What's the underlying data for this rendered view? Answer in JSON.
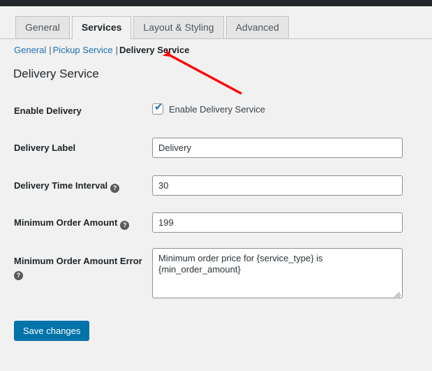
{
  "admin_bar": {
    "present": true,
    "color": "#23282d"
  },
  "tabs": [
    {
      "label": "General",
      "active": false
    },
    {
      "label": "Services",
      "active": true
    },
    {
      "label": "Layout & Styling",
      "active": false
    },
    {
      "label": "Advanced",
      "active": false
    }
  ],
  "subnav": {
    "items": [
      {
        "label": "General",
        "current": false
      },
      {
        "label": "Pickup Service",
        "current": false
      },
      {
        "label": "Delivery Service",
        "current": true
      }
    ],
    "separator": "|"
  },
  "page_title": "Delivery Service",
  "form": {
    "enable_delivery": {
      "label": "Enable Delivery",
      "checkbox_label": "Enable Delivery Service",
      "checked": true,
      "check_glyph": "✔"
    },
    "delivery_label": {
      "label": "Delivery Label",
      "value": "Delivery",
      "placeholder": ""
    },
    "delivery_time_interval": {
      "label": "Delivery Time Interval",
      "value": "30",
      "placeholder": "",
      "help": "?"
    },
    "minimum_order_amount": {
      "label": "Minimum Order Amount",
      "value": "199",
      "placeholder": "",
      "help": "?"
    },
    "minimum_order_amount_error": {
      "label": "Minimum Order Amount Error",
      "value": "Minimum order price for {service_type} is {min_order_amount}",
      "placeholder": "",
      "help": "?"
    }
  },
  "save_button": {
    "label": "Save changes"
  },
  "annotation": {
    "type": "arrow",
    "color": "#ff0000",
    "points_to": "Delivery Service"
  },
  "colors": {
    "page_background": "#f1f1f1",
    "admin_bar": "#23282d",
    "tab_inactive": "#e5e5e5",
    "tab_border": "#c3c4c7",
    "link": "#2271b1",
    "primary_button": "#0073aa",
    "input_border": "#8c8f94",
    "help_icon": "#5a5a5a"
  }
}
